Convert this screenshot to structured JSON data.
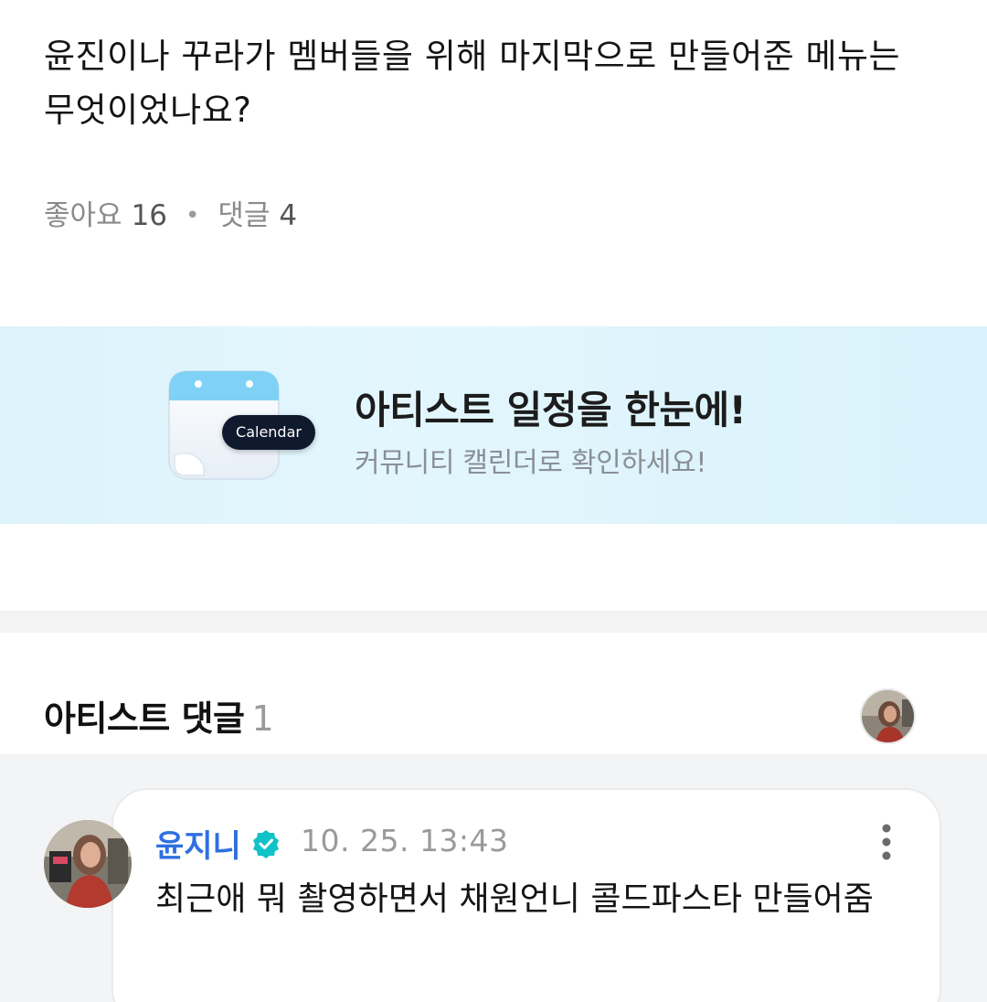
{
  "post": {
    "title": "윤진이나 꾸라가 멤버들을 위해 마지막으로 만들어준 메뉴는 무엇이었나요?",
    "likes_label": "좋아요",
    "likes_count": "16",
    "separator": "•",
    "comments_label": "댓글",
    "comments_count": "4"
  },
  "banner": {
    "pill_label": "Calendar",
    "title": "아티스트 일정을 한눈에!",
    "subtitle": "커뮤니티 캘린더로 확인하세요!",
    "icon": "calendar-icon"
  },
  "artist_comments": {
    "heading": "아티스트 댓글",
    "count": "1",
    "comments": [
      {
        "author": "윤지니",
        "time": "10. 25. 13:43",
        "text": "최근애 뭐 촬영하면서 채원언니 콜드파스타 만들어줌",
        "verified_icon": "verified-badge-icon"
      }
    ]
  },
  "colors": {
    "author": "#2f6fe0",
    "verified": "#12c2c9",
    "banner_bg": "#e0f5fc",
    "muted": "#8a8a8a"
  }
}
